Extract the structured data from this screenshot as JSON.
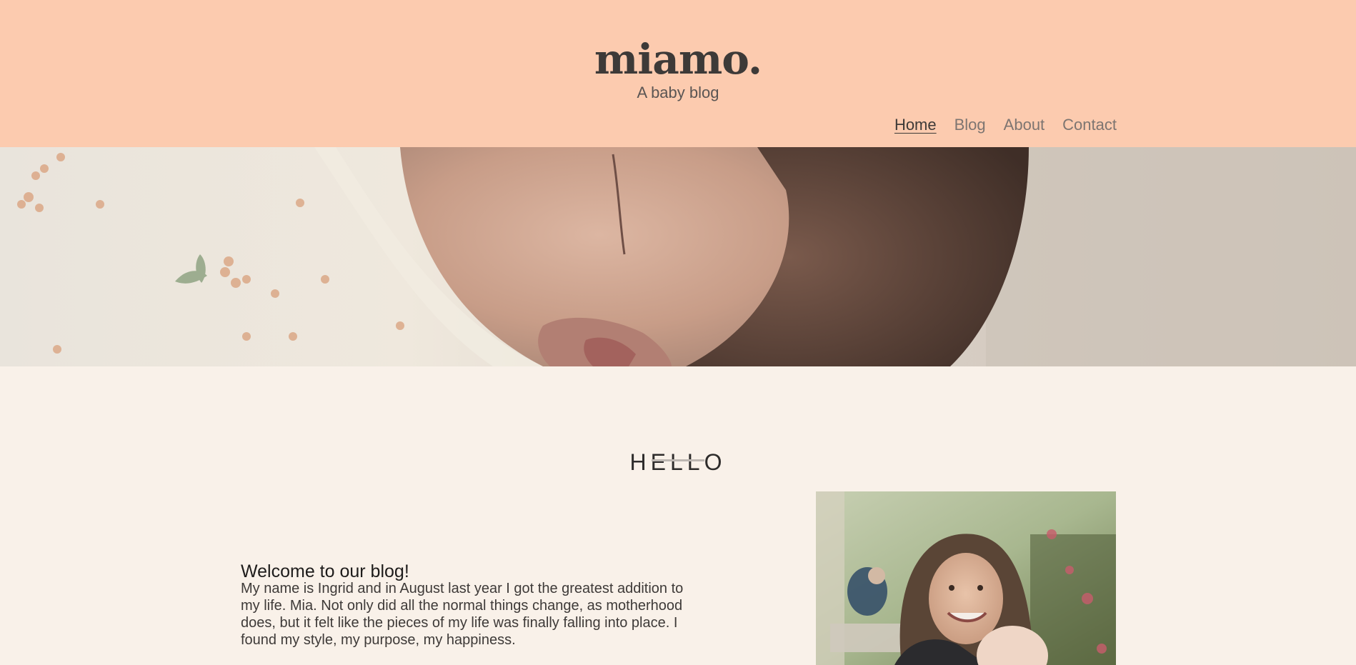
{
  "site": {
    "logo": "miamo.",
    "tagline": "A baby blog"
  },
  "nav": {
    "items": [
      {
        "label": "Home",
        "active": true
      },
      {
        "label": "Blog",
        "active": false
      },
      {
        "label": "About",
        "active": false
      },
      {
        "label": "Contact",
        "active": false
      }
    ]
  },
  "hero": {
    "image": "sleeping-baby-photo"
  },
  "section": {
    "heading": "HELLO"
  },
  "intro": {
    "title": "Welcome to our blog!",
    "body": "My name is Ingrid and in August last year I got the greatest addition to my life. Mia. Not only did all the normal things change, as motherhood does, but it felt like the pieces of my life was finally falling into place. I found my style, my purpose, my happiness."
  },
  "portrait": {
    "image": "mother-and-baby-photo"
  },
  "colors": {
    "header_bg": "#fccbaf",
    "page_bg": "#f9f1e9",
    "text_dark": "#3d3a38",
    "nav_text": "#7d7571"
  }
}
